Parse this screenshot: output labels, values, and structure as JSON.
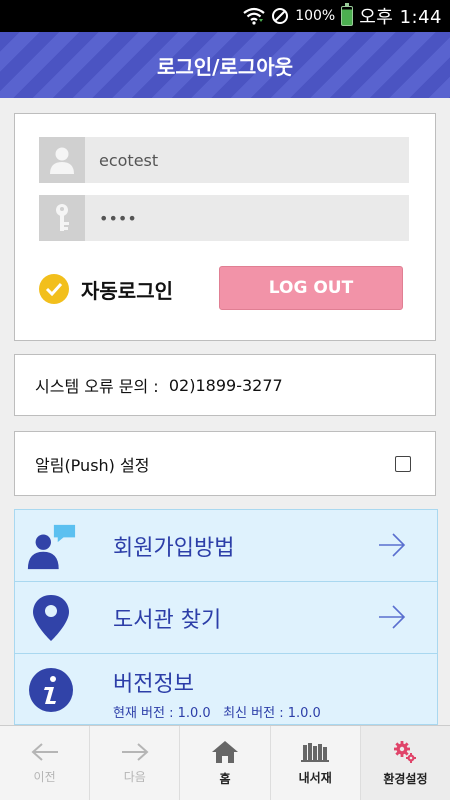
{
  "statusbar": {
    "battery": "100%",
    "time": "오후 1:44"
  },
  "header": {
    "title": "로그인/로그아웃"
  },
  "login": {
    "username": "ecotest",
    "password_mask": "••••",
    "auto_login_label": "자동로그인",
    "logout_label": "LOG OUT"
  },
  "support": {
    "label": "시스템 오류 문의 :",
    "phone": "02)1899-3277"
  },
  "push": {
    "label": "알림(Push) 설정",
    "checked": false
  },
  "menu": {
    "signup": "회원가입방법",
    "library": "도서관 찾기",
    "version": {
      "title": "버전정보",
      "current": "현재 버전 : 1.0.0",
      "latest": "최신 버전 : 1.0.0"
    }
  },
  "tabs": [
    {
      "label": "이전",
      "icon": "back-arrow-icon"
    },
    {
      "label": "다음",
      "icon": "forward-arrow-icon"
    },
    {
      "label": "홈",
      "icon": "home-icon"
    },
    {
      "label": "내서재",
      "icon": "bookshelf-icon"
    },
    {
      "label": "환경설정",
      "icon": "gear-icon"
    }
  ],
  "colors": {
    "header": "#4b54c2",
    "logout": "#f293a8",
    "menu_bg": "#dff2fd",
    "menu_text": "#2c3ea8",
    "check": "#f2bf1c",
    "settings_icon": "#e0456a"
  }
}
